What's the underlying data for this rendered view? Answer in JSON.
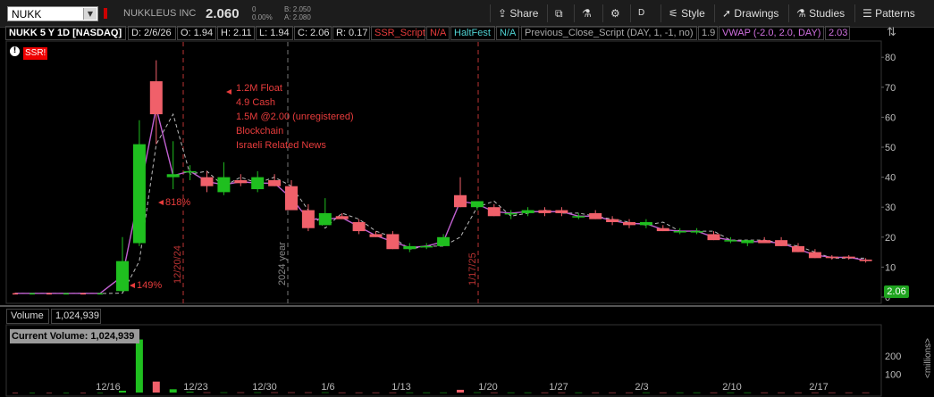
{
  "header": {
    "symbol": "NUKK",
    "company": "NUKKLEUS INC",
    "last": "2.060",
    "change": "0",
    "change_pct": "0.00%",
    "bid": "B: 2.050",
    "ask": "A: 2.080",
    "buttons": {
      "share": "Share",
      "period": "D",
      "style": "Style",
      "drawings": "Drawings",
      "studies": "Studies",
      "patterns": "Patterns"
    }
  },
  "studies": {
    "title": "NUKK 5 Y 1D [NASDAQ]",
    "d": "D: 2/6/26",
    "o": "O: 1.94",
    "h": "H: 2.11",
    "l": "L: 1.94",
    "c": "C: 2.06",
    "r": "R: 0.17",
    "ssr_name": "SSR_Script",
    "ssr_val": "N/A",
    "halt_name": "HaltFest",
    "halt_val": "N/A",
    "prev_name": "Previous_Close_Script (DAY, 1, -1, no)",
    "prev_val": "1.9",
    "vwap_name": "VWAP (-2.0, 2.0, DAY)",
    "vwap_val": "2.03"
  },
  "badges": {
    "ssr": "SSR!",
    "info": "!",
    "price": "2.06"
  },
  "annotations": {
    "lines": [
      "1.2M Float",
      "4.9 Cash",
      "1.5M @2.00 (unregistered)",
      "Blockchain",
      "Israeli Related News"
    ],
    "pct_818": "818%",
    "pct_149": "149%",
    "vline_1": "12/20/24",
    "vline_2": "2024 year",
    "vline_3": "1/17/25"
  },
  "volume": {
    "title": "Volume",
    "value": "1,024,939",
    "current": "Current Volume: 1,024,939",
    "unit": "<millions>"
  },
  "colors": {
    "up": "#1fbf1f",
    "down": "#f0606a",
    "vwap": "#c060d0",
    "prev_close": "#bbbbbb",
    "annotation": "#e83c3c"
  },
  "chart_data": {
    "type": "candlestick",
    "price_ticks": [
      0,
      10,
      20,
      30,
      40,
      50,
      60,
      70,
      80
    ],
    "volume_ticks": [
      100,
      200
    ],
    "x_labels": [
      "12/16",
      "12/23",
      "12/30",
      "1/6",
      "1/13",
      "1/20",
      "1/27",
      "2/3",
      "2/10",
      "2/17"
    ],
    "candles": [
      {
        "o": 1.3,
        "h": 1.5,
        "l": 1.1,
        "c": 1.2
      },
      {
        "o": 1.2,
        "h": 1.4,
        "l": 1.1,
        "c": 1.3
      },
      {
        "o": 1.3,
        "h": 1.5,
        "l": 1.1,
        "c": 1.2
      },
      {
        "o": 1.2,
        "h": 1.4,
        "l": 1.0,
        "c": 1.3
      },
      {
        "o": 1.3,
        "h": 1.5,
        "l": 1.2,
        "c": 1.2
      },
      {
        "o": 1.2,
        "h": 1.4,
        "l": 1.1,
        "c": 1.3
      },
      {
        "o": 2.0,
        "h": 20.0,
        "l": 1.8,
        "c": 12.0
      },
      {
        "o": 18.0,
        "h": 59.0,
        "l": 17.0,
        "c": 51.0
      },
      {
        "o": 72.0,
        "h": 79.0,
        "l": 51.0,
        "c": 61.0
      },
      {
        "o": 40.0,
        "h": 52.0,
        "l": 36.0,
        "c": 41.0
      },
      {
        "o": 42.0,
        "h": 44.0,
        "l": 39.0,
        "c": 42.0
      },
      {
        "o": 40.0,
        "h": 42.0,
        "l": 35.0,
        "c": 37.0
      },
      {
        "o": 35.0,
        "h": 45.0,
        "l": 34.0,
        "c": 40.0
      },
      {
        "o": 39.0,
        "h": 41.0,
        "l": 37.0,
        "c": 38.0
      },
      {
        "o": 36.0,
        "h": 42.0,
        "l": 35.0,
        "c": 40.0
      },
      {
        "o": 39.0,
        "h": 41.0,
        "l": 37.0,
        "c": 37.0
      },
      {
        "o": 37.0,
        "h": 39.0,
        "l": 29.0,
        "c": 29.0
      },
      {
        "o": 29.0,
        "h": 31.0,
        "l": 22.0,
        "c": 23.0
      },
      {
        "o": 24.0,
        "h": 33.0,
        "l": 24.0,
        "c": 28.0
      },
      {
        "o": 27.0,
        "h": 28.0,
        "l": 26.0,
        "c": 26.0
      },
      {
        "o": 25.0,
        "h": 26.0,
        "l": 21.0,
        "c": 22.0
      },
      {
        "o": 21.0,
        "h": 22.0,
        "l": 20.0,
        "c": 20.0
      },
      {
        "o": 21.0,
        "h": 22.0,
        "l": 16.0,
        "c": 16.0
      },
      {
        "o": 16.0,
        "h": 18.0,
        "l": 15.0,
        "c": 17.0
      },
      {
        "o": 17.0,
        "h": 18.0,
        "l": 16.0,
        "c": 17.0
      },
      {
        "o": 17.0,
        "h": 21.0,
        "l": 17.0,
        "c": 20.0
      },
      {
        "o": 34.0,
        "h": 40.0,
        "l": 30.0,
        "c": 30.0
      },
      {
        "o": 30.0,
        "h": 32.0,
        "l": 29.0,
        "c": 32.0
      },
      {
        "o": 30.0,
        "h": 31.0,
        "l": 27.0,
        "c": 27.0
      },
      {
        "o": 28.0,
        "h": 29.0,
        "l": 26.0,
        "c": 28.0
      },
      {
        "o": 28.0,
        "h": 30.0,
        "l": 27.0,
        "c": 29.0
      },
      {
        "o": 29.0,
        "h": 30.0,
        "l": 27.0,
        "c": 28.0
      },
      {
        "o": 29.0,
        "h": 30.0,
        "l": 27.0,
        "c": 28.0
      },
      {
        "o": 27.0,
        "h": 28.0,
        "l": 26.0,
        "c": 27.0
      },
      {
        "o": 28.0,
        "h": 29.0,
        "l": 26.0,
        "c": 26.0
      },
      {
        "o": 26.0,
        "h": 27.0,
        "l": 24.0,
        "c": 25.0
      },
      {
        "o": 25.0,
        "h": 26.0,
        "l": 23.0,
        "c": 24.0
      },
      {
        "o": 24.0,
        "h": 26.0,
        "l": 23.0,
        "c": 25.0
      },
      {
        "o": 23.0,
        "h": 24.0,
        "l": 22.0,
        "c": 22.0
      },
      {
        "o": 22.0,
        "h": 23.0,
        "l": 21.0,
        "c": 22.0
      },
      {
        "o": 22.0,
        "h": 23.0,
        "l": 21.0,
        "c": 22.0
      },
      {
        "o": 21.0,
        "h": 22.0,
        "l": 19.0,
        "c": 19.0
      },
      {
        "o": 19.0,
        "h": 20.0,
        "l": 18.0,
        "c": 19.0
      },
      {
        "o": 18.0,
        "h": 19.0,
        "l": 17.0,
        "c": 19.0
      },
      {
        "o": 19.0,
        "h": 20.0,
        "l": 18.0,
        "c": 18.0
      },
      {
        "o": 19.0,
        "h": 20.0,
        "l": 17.0,
        "c": 17.0
      },
      {
        "o": 17.0,
        "h": 18.0,
        "l": 15.0,
        "c": 15.0
      },
      {
        "o": 15.0,
        "h": 16.0,
        "l": 13.0,
        "c": 13.0
      },
      {
        "o": 13.5,
        "h": 14.0,
        "l": 12.5,
        "c": 13.0
      },
      {
        "o": 13.5,
        "h": 14.0,
        "l": 12.5,
        "c": 13.0
      },
      {
        "o": 12.5,
        "h": 13.0,
        "l": 11.5,
        "c": 12.0
      }
    ],
    "volumes_millions": [
      0,
      0,
      0,
      0,
      0,
      0,
      10,
      290,
      60,
      18,
      4,
      1,
      1,
      1,
      1,
      1,
      1,
      1,
      1,
      0.5,
      0.5,
      0.5,
      0.5,
      0.5,
      0.5,
      0.5,
      15,
      1,
      0.5,
      0.5,
      0.5,
      0.5,
      0.5,
      0.5,
      0.5,
      0.5,
      0.5,
      0.5,
      0.5,
      0.5,
      0.5,
      0.5,
      0.5,
      0.5,
      0.5,
      0.5,
      0.5,
      0.5,
      0.5,
      0.5,
      0.5
    ]
  }
}
